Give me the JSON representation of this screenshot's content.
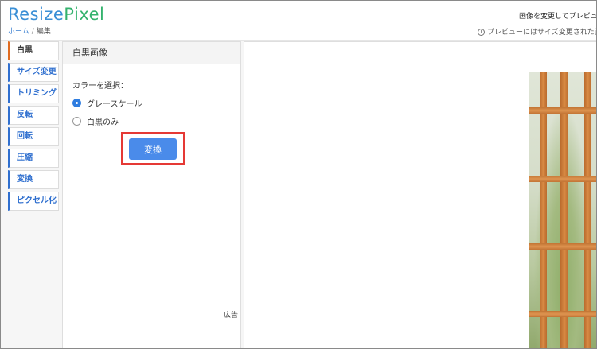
{
  "app": {
    "logo_part1": "Resize",
    "logo_part2": "Pixel"
  },
  "breadcrumb": {
    "home": "ホーム",
    "separator": "/",
    "current": "編集"
  },
  "header": {
    "title": "画像を変更してプレビュー",
    "info_icon": "i",
    "note": "プレビューにはサイズ変更された画像が"
  },
  "sidebar": {
    "items": [
      {
        "label": "白黒",
        "active": true
      },
      {
        "label": "サイズ変更",
        "active": false
      },
      {
        "label": "トリミング",
        "active": false
      },
      {
        "label": "反転",
        "active": false
      },
      {
        "label": "回転",
        "active": false
      },
      {
        "label": "圧縮",
        "active": false
      },
      {
        "label": "変換",
        "active": false
      },
      {
        "label": "ピクセル化",
        "active": false
      }
    ]
  },
  "panel": {
    "title": "白黒画像",
    "select_label": "カラーを選択：",
    "options": [
      {
        "label": "グレースケール",
        "checked": true
      },
      {
        "label": "白黒のみ",
        "checked": false
      }
    ],
    "convert_button": "変換",
    "ad_label": "広告"
  },
  "colors": {
    "accent_blue": "#2f6fcf",
    "button_blue": "#4a8bea",
    "highlight_red": "#e53935",
    "active_orange": "#e06b1f"
  }
}
